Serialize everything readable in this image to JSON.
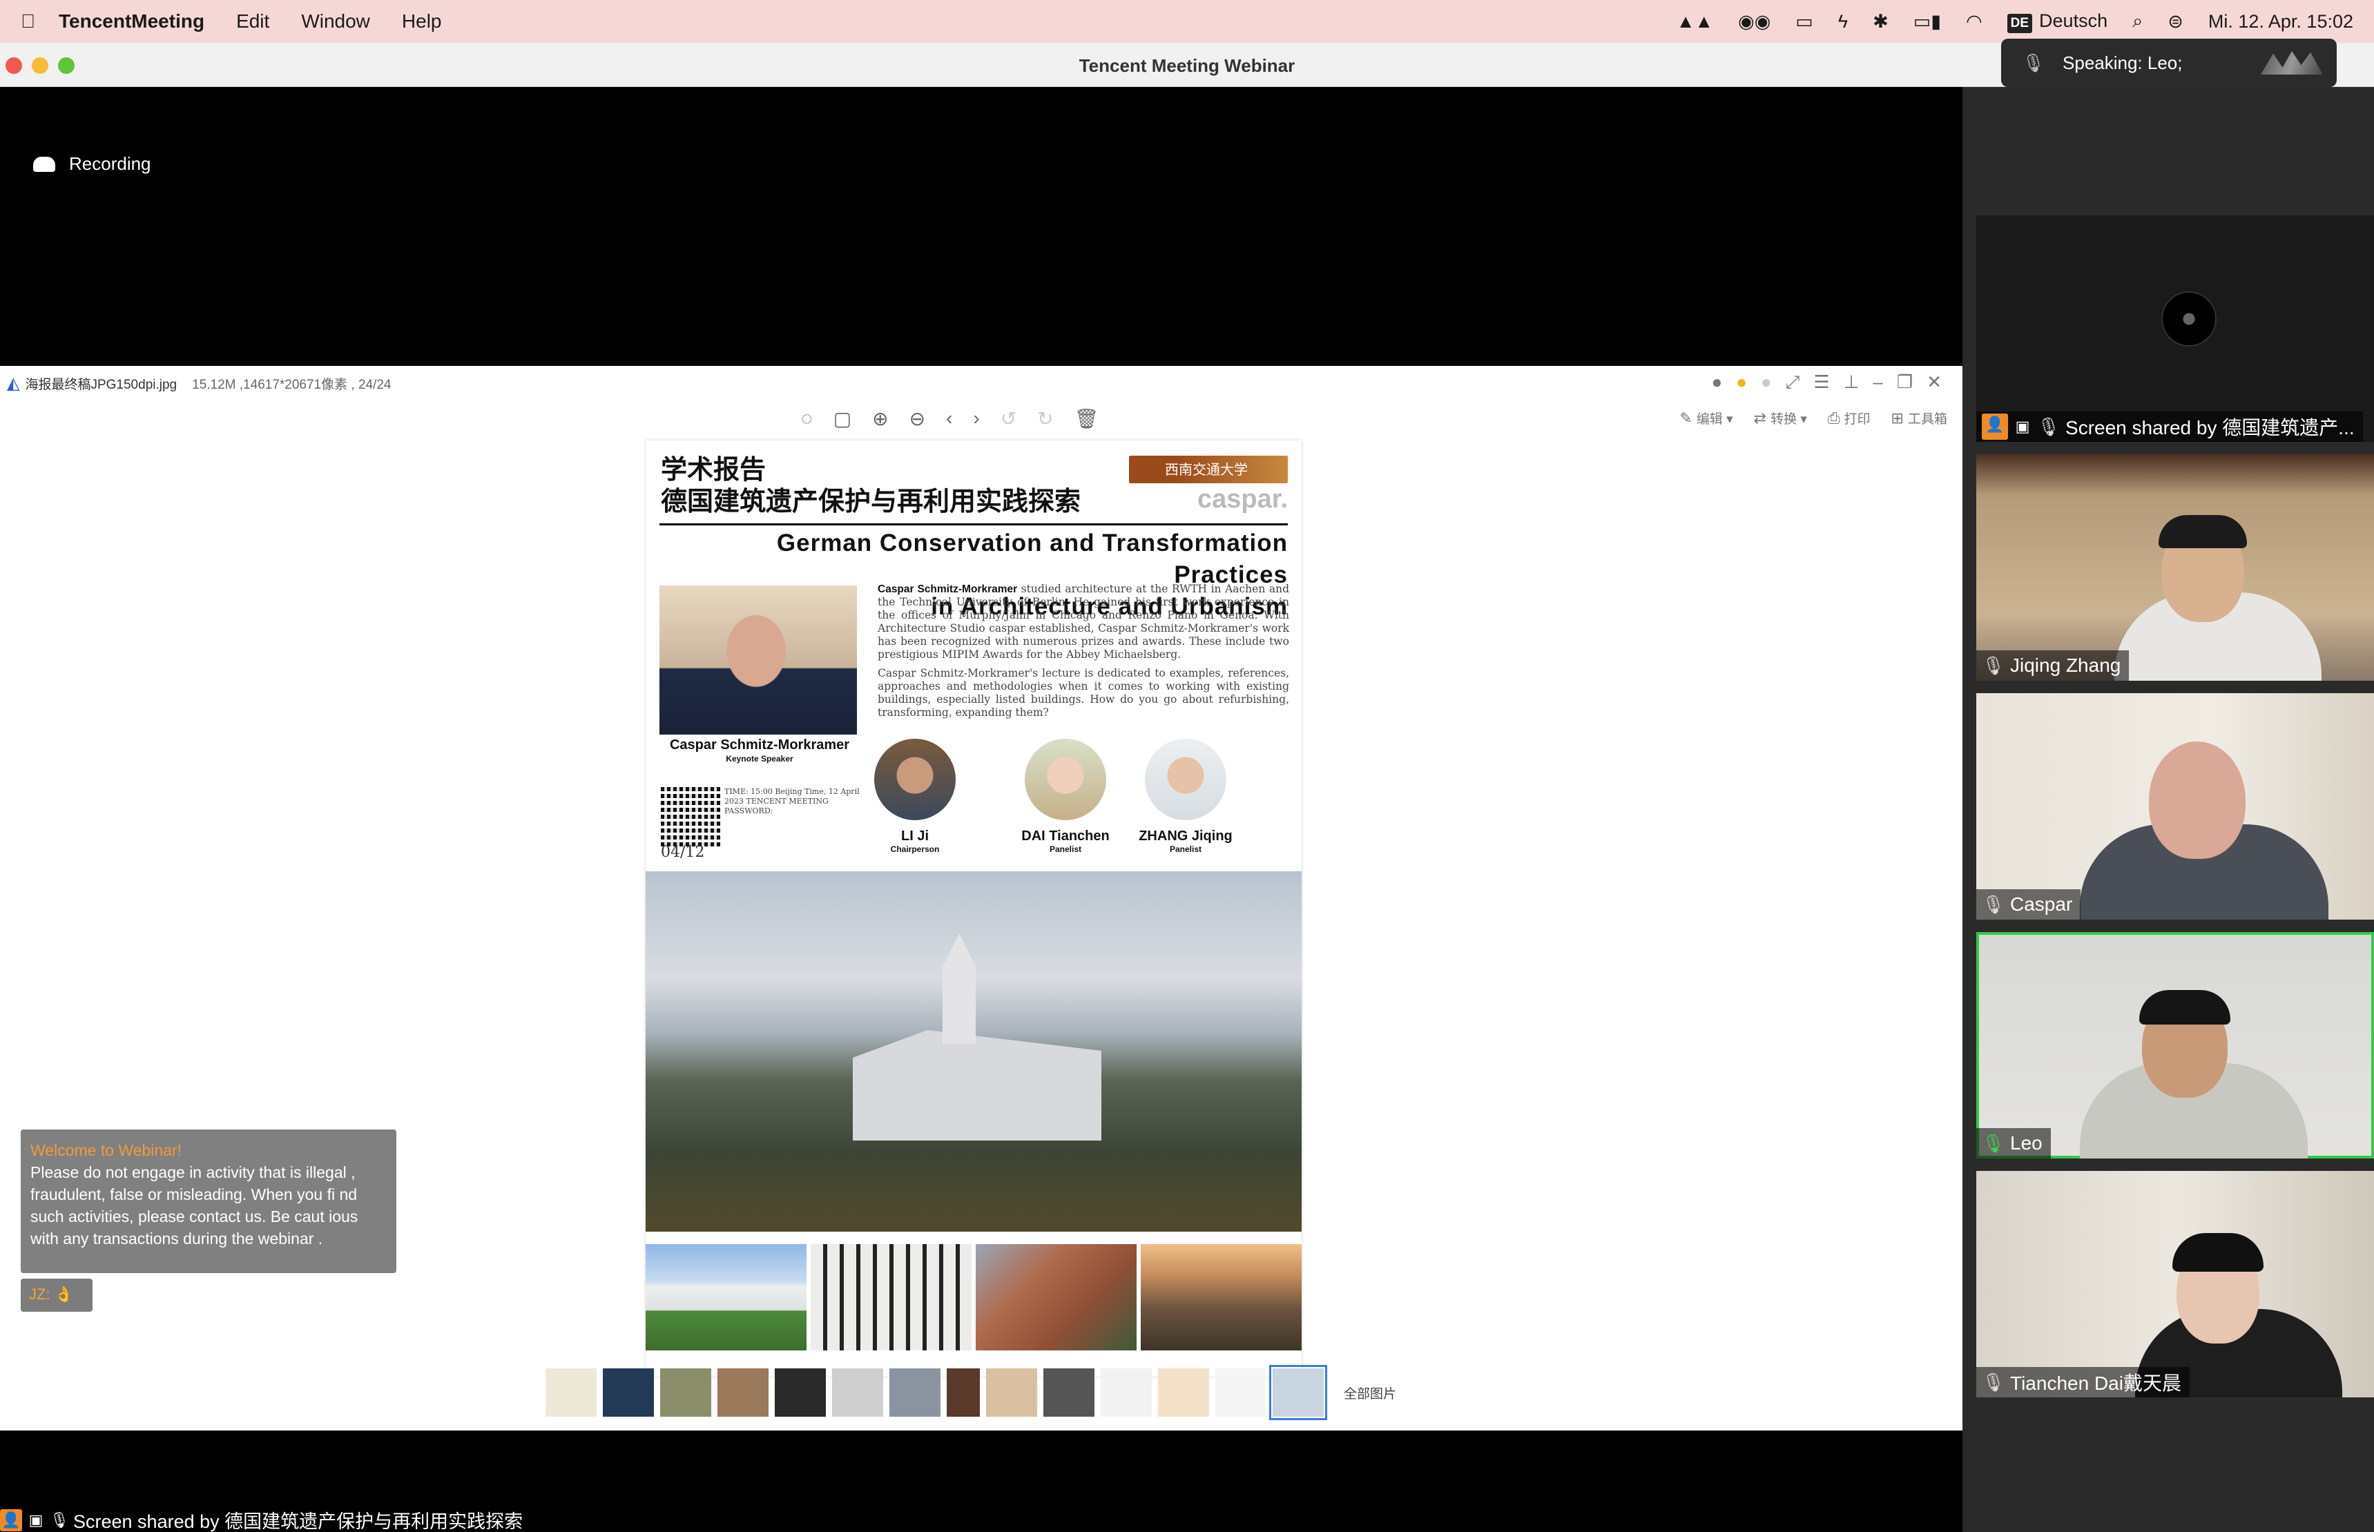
{
  "menubar": {
    "apple_icon": "apple-logo-icon",
    "app_name": "TencentMeeting",
    "menus": [
      "Edit",
      "Window",
      "Help"
    ],
    "input_source": "Deutsch",
    "input_badge": "DE",
    "datetime": "Mi. 12. Apr.  15:02"
  },
  "window": {
    "title": "Tencent Meeting Webinar"
  },
  "speaking": {
    "label": "Speaking: Leo;"
  },
  "recording": {
    "label": "Recording"
  },
  "viewer": {
    "filename": "海报最终稿JPG150dpi.jpg",
    "meta": "15.12M ,14617*20671像素 , 24/24",
    "right_tools": [
      "编辑",
      "转换",
      "打印",
      "工具箱"
    ],
    "all_images": "全部图片"
  },
  "poster": {
    "cn_title_line1": "学术报告",
    "cn_title_line2": "德国建筑遗产保护与再利用实践探索",
    "school": "西南交通大学",
    "brand": "caspar.",
    "en_title_line1": "German Conservation and Transformation Practices",
    "en_title_line2": "in Architecture and Urbanism",
    "speaker_name": "Caspar Schmitz-Morkramer",
    "speaker_role": "Keynote Speaker",
    "bio_lead": "Caspar Schmitz-Morkramer",
    "bio_p1": " studied architecture at the RWTH in Aachen and the Technical University of Berlin. He gained his first work experience in the offices of Murphy/Jahn in Chicago and Renzo Piano in Genoa. With Architecture Studio caspar established, Caspar Schmitz-Morkramer's work has been recognized with numerous prizes and awards. These include two prestigious MIPIM Awards for the Abbey Michaelsberg.",
    "bio_p2": "Caspar Schmitz-Morkramer's lecture is dedicated to examples, references, approaches and methodologies when it comes to working with existing buildings, especially listed buildings. How do you go about refurbishing, transforming, expanding them?",
    "meeting_info": "TIME: 15:00 Beijing Time, 12 April 2023 TENCENT MEETING PASSWORD:",
    "date": "04/12",
    "panelists": [
      {
        "name": "LI Ji",
        "role": "Chairperson"
      },
      {
        "name": "DAI Tianchen",
        "role": "Panelist"
      },
      {
        "name": "ZHANG Jiqing",
        "role": "Panelist"
      }
    ]
  },
  "welcome": {
    "title": "Welcome to Webinar!",
    "body": "Please do not engage in activity that is illegal , fraudulent, false or misleading. When you fi nd such activities, please contact us. Be caut ious with any transactions during the webinar ."
  },
  "reaction": {
    "text": "JZ: 👌"
  },
  "bottom_share": {
    "label": "Screen shared by 德国建筑遗产保护与再利用实践探索"
  },
  "participants": [
    {
      "name": "Screen shared by 德国建筑遗产...",
      "active": false
    },
    {
      "name": "Jiqing Zhang",
      "active": false
    },
    {
      "name": "Caspar",
      "active": false
    },
    {
      "name": "Leo",
      "active": true
    },
    {
      "name": "Tianchen Dai戴天晨",
      "active": false
    }
  ],
  "colors": {
    "menubar_bg": "#f5d8d6",
    "active_speaker": "#35c84a",
    "welcome_title": "#f39a3a",
    "selection": "#3b78e7"
  }
}
